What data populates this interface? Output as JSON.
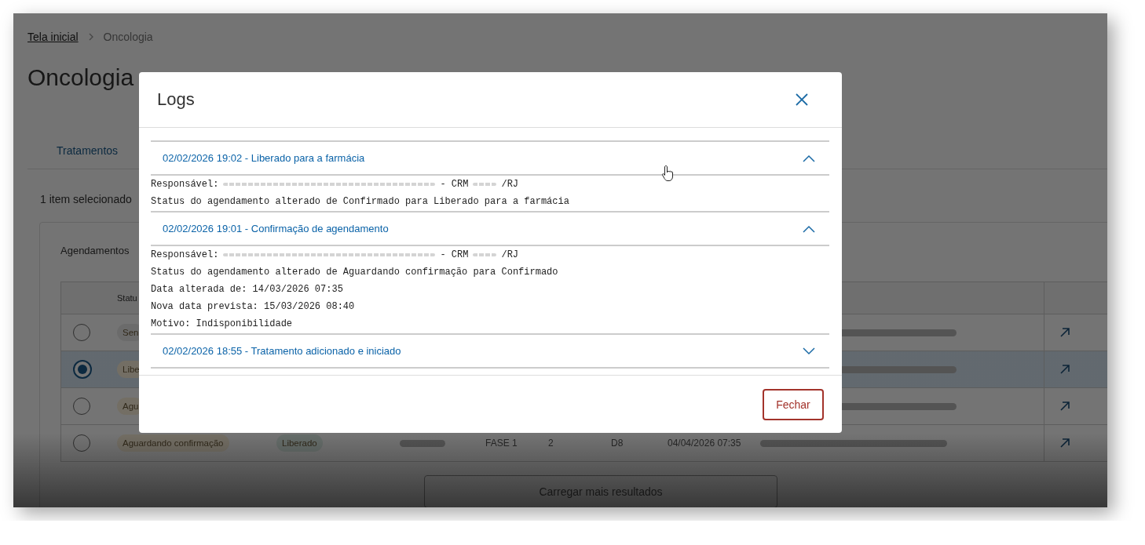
{
  "page": {
    "breadcrumb": [
      {
        "label": "Tela inicial",
        "kind": "link"
      },
      {
        "label": "Oncologia",
        "kind": "current"
      }
    ],
    "title": "Oncologia",
    "tabs": [
      {
        "label": "Tratamentos",
        "selected": true
      }
    ],
    "selection_count": "1 item selecionado",
    "card": {
      "title": "Agendamentos",
      "table": {
        "columns": [
          "Statu"
        ],
        "rows": [
          {
            "selected": false,
            "status": {
              "label": "Sen",
              "color": "#6b6b6b"
            },
            "name_redacted": true
          },
          {
            "selected": true,
            "status": {
              "label": "Libe",
              "color": "#736e64"
            },
            "name_redacted": true
          },
          {
            "selected": false,
            "status": {
              "label": "Agu",
              "color": "#736e64"
            },
            "name_redacted": true
          },
          {
            "selected": false,
            "status": {
              "label": "Aguardando confirmação",
              "color": "#736e64"
            },
            "pharmacy": {
              "label": "Liberado",
              "color": "#666d6a"
            },
            "protocol_redacted": true,
            "phase": "FASE 1",
            "cycle": "2",
            "day": "D8",
            "date": "04/04/2026 07:35",
            "name_redacted": true
          }
        ]
      },
      "load_more": "Carregar mais resultados"
    }
  },
  "logs_dialog": {
    "title": "Logs",
    "entries": [
      {
        "heading": "02/02/2026 19:02 - Liberado para a farmácia",
        "expanded": true,
        "lines": [
          {
            "kind": "responsible",
            "label": "Responsável:",
            "crm": "- CRM",
            "suffix": "/RJ"
          },
          {
            "kind": "text",
            "text": "Status do agendamento alterado de Confirmado para Liberado para a farmácia"
          }
        ]
      },
      {
        "heading": "02/02/2026 19:01 - Confirmação de agendamento",
        "expanded": true,
        "lines": [
          {
            "kind": "responsible",
            "label": "Responsável:",
            "crm": "- CRM",
            "suffix": "/RJ"
          },
          {
            "kind": "text",
            "text": "Status do agendamento alterado de Aguardando confirmação para Confirmado"
          },
          {
            "kind": "text",
            "text": "Data alterada de: 14/03/2026 07:35"
          },
          {
            "kind": "text",
            "text": "Nova data prevista: 15/03/2026 08:40"
          },
          {
            "kind": "text",
            "text": "Motivo: Indisponibilidade"
          }
        ]
      },
      {
        "heading": "02/02/2026 18:55 - Tratamento adicionado e iniciado",
        "expanded": false
      }
    ],
    "close_button": "Fechar"
  }
}
